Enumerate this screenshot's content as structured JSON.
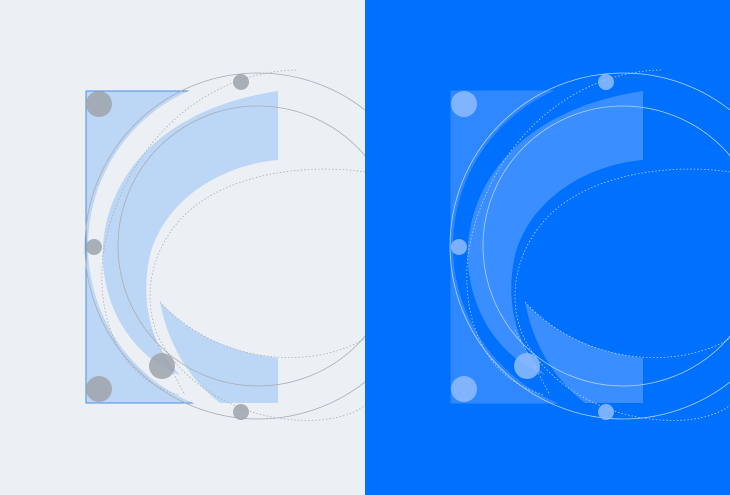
{
  "panels": [
    {
      "id": "light",
      "background": "#ecf0f5",
      "frame_fill": "#bcd6f5",
      "frame_stroke": "#4a90e2",
      "inner_fill": "#ecf0f5",
      "guide_stroke": "#a9adb3",
      "node_fill": "#9ea3aa",
      "mark_fill": "#bcd6f5"
    },
    {
      "id": "dark",
      "background": "#0070ff",
      "frame_fill": "#2f88ff",
      "frame_stroke": "#2f88ff",
      "inner_fill": "#0070ff",
      "guide_stroke": "#b3d3ff",
      "node_fill": "#8fbcff",
      "mark_fill": "#3a8eff"
    }
  ]
}
